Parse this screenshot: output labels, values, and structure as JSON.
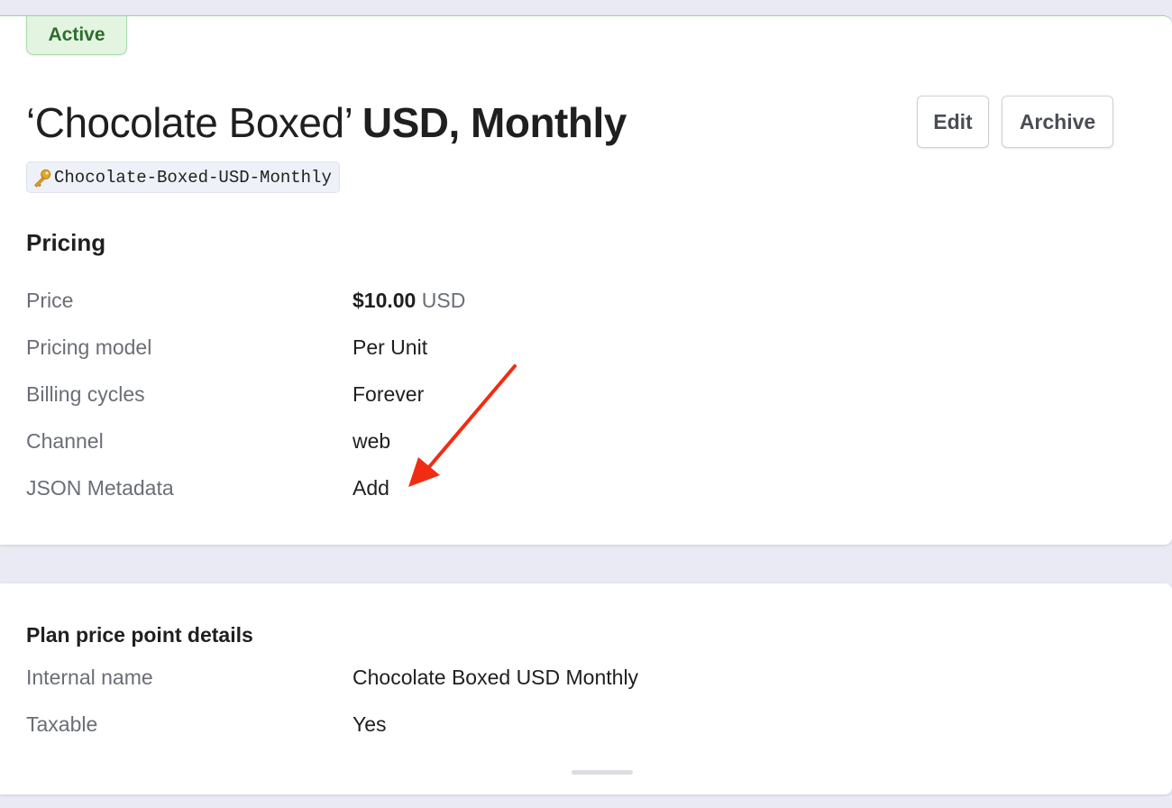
{
  "status": {
    "label": "Active",
    "color": "#2c6e2c",
    "background": "#e3f4e1"
  },
  "plan": {
    "title_name": "‘Chocolate Boxed’",
    "title_suffix": "USD, Monthly",
    "key_icon": "key-icon",
    "key": "Chocolate-Boxed-USD-Monthly"
  },
  "actions": {
    "edit_label": "Edit",
    "archive_label": "Archive"
  },
  "pricing": {
    "title": "Pricing",
    "rows": [
      {
        "label": "Price",
        "amount": "$10.00",
        "currency": "USD"
      },
      {
        "label": "Pricing model",
        "value": "Per Unit"
      },
      {
        "label": "Billing cycles",
        "value": "Forever"
      },
      {
        "label": "Channel",
        "value": "web"
      },
      {
        "label": "JSON Metadata",
        "value": "Add"
      }
    ]
  },
  "details": {
    "title": "Plan price point details",
    "rows": [
      {
        "label": "Internal name",
        "value": "Chocolate Boxed USD Monthly"
      },
      {
        "label": "Taxable",
        "value": "Yes"
      }
    ]
  },
  "colors": {
    "link": "#2f6fd1",
    "annotation_arrow": "#f02d13",
    "page_bg": "#e9eaf3"
  }
}
